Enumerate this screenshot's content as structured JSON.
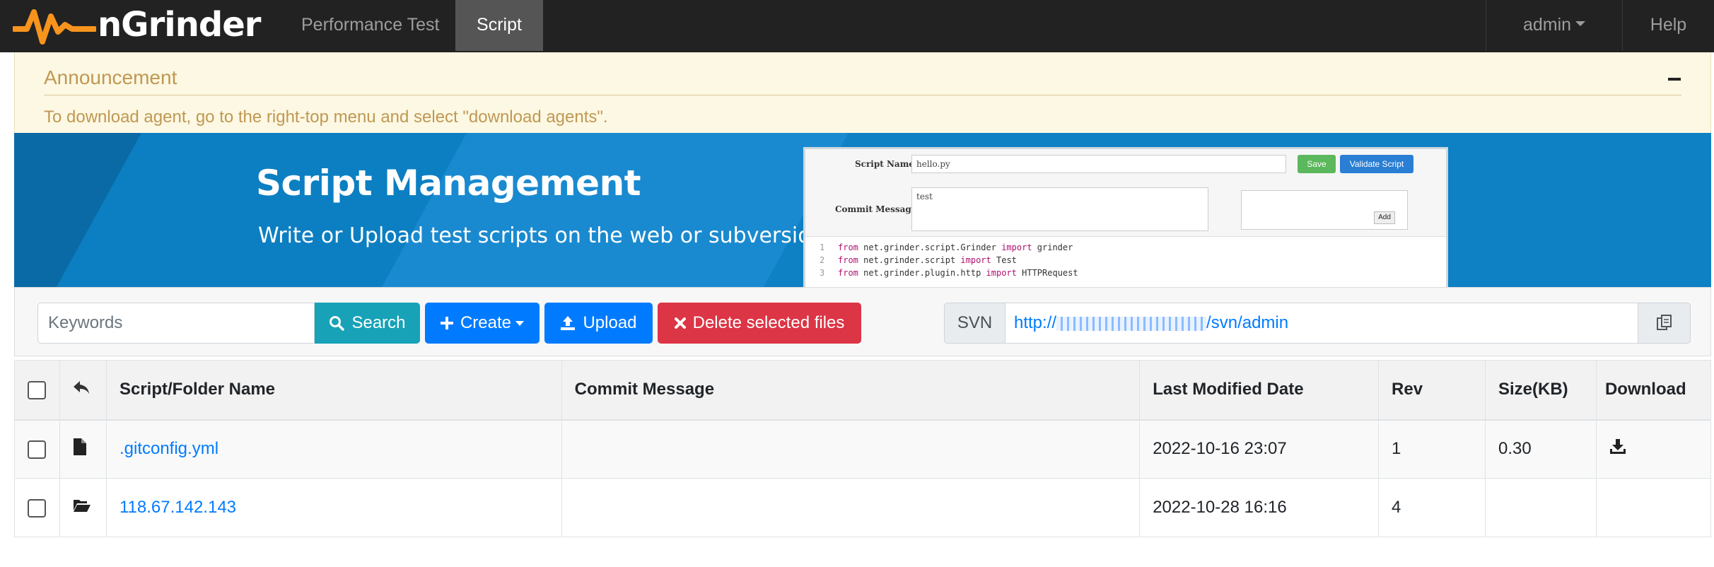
{
  "app": {
    "logo_text": "nGrinder"
  },
  "nav": {
    "items": [
      {
        "label": "Performance Test",
        "active": false
      },
      {
        "label": "Script",
        "active": true
      }
    ],
    "user": "admin",
    "help": "Help"
  },
  "announcement": {
    "title": "Announcement",
    "text": "To download agent, go to the right-top menu and select \"download agents\"."
  },
  "banner": {
    "title": "Script Management",
    "subtitle": "Write or Upload test scripts on the web or subversion",
    "mock": {
      "script_name_label": "Script Name",
      "script_name_value": "hello.py",
      "save": "Save",
      "validate": "Validate Script",
      "commit_label": "Commit Message",
      "commit_value": "test",
      "add": "Add",
      "code": [
        {
          "n": "1",
          "pre": "",
          "kw1": "from",
          "mid": " net.grinder.script.Grinder ",
          "kw2": "import",
          "post": " grinder"
        },
        {
          "n": "2",
          "pre": "",
          "kw1": "from",
          "mid": " net.grinder.script ",
          "kw2": "import",
          "post": " Test"
        },
        {
          "n": "3",
          "pre": "",
          "kw1": "from",
          "mid": " net.grinder.plugin.http ",
          "kw2": "import",
          "post": " HTTPRequest"
        }
      ]
    }
  },
  "toolbar": {
    "keywords_placeholder": "Keywords",
    "search": "Search",
    "create": "Create",
    "upload": "Upload",
    "delete": "Delete selected files",
    "svn_label": "SVN",
    "svn_url_prefix": "http://",
    "svn_url_suffix": "/svn/admin"
  },
  "table": {
    "columns": [
      "Script/Folder Name",
      "Commit Message",
      "Last Modified Date",
      "Rev",
      "Size(KB)",
      "Download"
    ],
    "rows": [
      {
        "type": "file",
        "name": ".gitconfig.yml",
        "commit": "",
        "date": "2022-10-16 23:07",
        "rev": "1",
        "size": "0.30",
        "download": true
      },
      {
        "type": "folder",
        "name": "118.67.142.143",
        "commit": "",
        "date": "2022-10-28 16:16",
        "rev": "4",
        "size": "",
        "download": false
      }
    ]
  },
  "colors": {
    "navbar": "#222222",
    "announcement_bg": "#fcf8e3",
    "announcement_text": "#c09853",
    "banner": "#0b78b9",
    "search": "#17a2b8",
    "primary": "#007bff",
    "danger": "#dc3545",
    "link": "#007bff"
  }
}
